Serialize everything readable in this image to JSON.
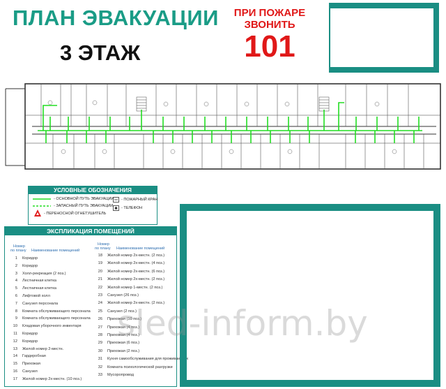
{
  "header": {
    "title": "ПЛАН ЭВАКУАЦИИ",
    "floor": "3 ЭТАЖ",
    "fire_line1": "ПРИ ПОЖАРЕ",
    "fire_line2": "ЗВОНИТЬ",
    "fire_number": "101"
  },
  "colors": {
    "accent": "#1a8e83",
    "title": "#1a9c86",
    "alarm": "#e01818",
    "route": "#22dd22"
  },
  "legend": {
    "title": "УСЛОВНЫЕ ОБОЗНАЧЕНИЯ",
    "main_route": "- ОСНОВНОЙ ПУТЬ ЭВАКУАЦИИ",
    "spare_route": "- ЗАПАСНЫЙ ПУТЬ ЭВАКУАЦИИ",
    "extinguisher": "- ПЕРЕНОСНОЙ ОГНЕТУШИТЕЛЬ",
    "hydrant": "- ПОЖАРНЫЙ КРАН",
    "phone": "- ТЕЛЕФОН",
    "extinguisher_icon": "fire-extinguisher-icon",
    "hydrant_icon": "fire-hydrant-icon",
    "phone_icon": "phone-icon"
  },
  "explication": {
    "title": "ЭКСПЛИКАЦИЯ ПОМЕЩЕНИЙ",
    "col_num_1": "Номер",
    "col_num_2": "по плану",
    "col_name": "Наименование   помещений",
    "left_rows": [
      {
        "n": "1",
        "name": "Коридор"
      },
      {
        "n": "2",
        "name": "Коридор"
      },
      {
        "n": "3",
        "name": "Холл-рекреация (2 поз.)"
      },
      {
        "n": "4",
        "name": "Лестничная клетка"
      },
      {
        "n": "5",
        "name": "Лестничная клетка"
      },
      {
        "n": "6",
        "name": "Лифтовой холл"
      },
      {
        "n": "7",
        "name": "Санузел персонала"
      },
      {
        "n": "8",
        "name": "Комната обслуживающего персонала"
      },
      {
        "n": "9",
        "name": "Комната обслуживающего персонала"
      },
      {
        "n": "10",
        "name": "Кладовая уборочного инвентаря"
      },
      {
        "n": "11",
        "name": "Коридор"
      },
      {
        "n": "12",
        "name": "Коридор"
      },
      {
        "n": "13",
        "name": "Жилой номер 2-местн."
      },
      {
        "n": "14",
        "name": "Гардеробная"
      },
      {
        "n": "15",
        "name": "Прихожая"
      },
      {
        "n": "16",
        "name": "Санузел"
      },
      {
        "n": "17",
        "name": "Жилой номер 2х-местн. (10 поз.)"
      }
    ],
    "right_rows": [
      {
        "n": "18",
        "name": "Жилой номер 2х-местн. (2 поз.)"
      },
      {
        "n": "19",
        "name": "Жилой номер 2х-местн. (4 поз.)"
      },
      {
        "n": "20",
        "name": "Жилой номер 2х-местн. (6 поз.)"
      },
      {
        "n": "21",
        "name": "Жилой номер 2х-местн. (2 поз.)"
      },
      {
        "n": "22",
        "name": "Жилой номер 1-местн. (2 поз.)"
      },
      {
        "n": "23",
        "name": "Санузел (26 поз.)"
      },
      {
        "n": "24",
        "name": "Жилой номер 2х-местн. (2 поз.)"
      },
      {
        "n": "25",
        "name": "Санузел (2 поз.)"
      },
      {
        "n": "26",
        "name": "Прихожая (10 поз.)"
      },
      {
        "n": "27",
        "name": "Прихожая (4 поз.)"
      },
      {
        "n": "28",
        "name": "Прихожая (4 поз.)"
      },
      {
        "n": "29",
        "name": "Прихожая (6 поз.)"
      },
      {
        "n": "30",
        "name": "Прихожая (2 поз.)"
      },
      {
        "n": "31",
        "name": "Кухня самообслуживания для проживающих"
      },
      {
        "n": "32",
        "name": "Комната психологической разгрузки"
      },
      {
        "n": "33",
        "name": "Мусоропровод"
      }
    ]
  },
  "watermark": "sled-inform.by"
}
